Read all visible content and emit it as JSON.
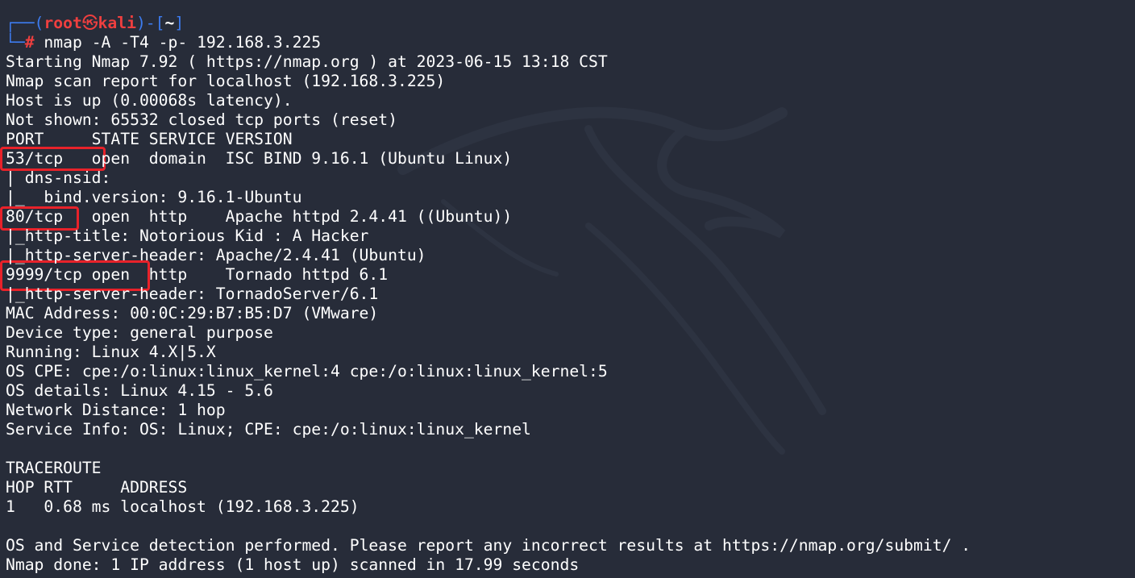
{
  "prompt": {
    "top_left": "┌──(",
    "user": "root",
    "skull": "㉿",
    "host": "kali",
    "mid": ")-[",
    "dir": "~",
    "end": "]",
    "bottom_left": "└─",
    "hash": "#",
    "command": " nmap -A -T4 -p- 192.168.3.225"
  },
  "output_lines": [
    "Starting Nmap 7.92 ( https://nmap.org ) at 2023-06-15 13:18 CST",
    "Nmap scan report for localhost (192.168.3.225)",
    "Host is up (0.00068s latency).",
    "Not shown: 65532 closed tcp ports (reset)",
    "PORT     STATE SERVICE VERSION",
    "53/tcp   open  domain  ISC BIND 9.16.1 (Ubuntu Linux)",
    "| dns-nsid: ",
    "|_  bind.version: 9.16.1-Ubuntu",
    "80/tcp   open  http    Apache httpd 2.4.41 ((Ubuntu))",
    "|_http-title: Notorious Kid : A Hacker",
    "|_http-server-header: Apache/2.4.41 (Ubuntu)",
    "9999/tcp open  http    Tornado httpd 6.1",
    "|_http-server-header: TornadoServer/6.1",
    "MAC Address: 00:0C:29:B7:B5:D7 (VMware)",
    "Device type: general purpose",
    "Running: Linux 4.X|5.X",
    "OS CPE: cpe:/o:linux:linux_kernel:4 cpe:/o:linux:linux_kernel:5",
    "OS details: Linux 4.15 - 5.6",
    "Network Distance: 1 hop",
    "Service Info: OS: Linux; CPE: cpe:/o:linux:linux_kernel",
    "",
    "TRACEROUTE",
    "HOP RTT     ADDRESS",
    "1   0.68 ms localhost (192.168.3.225)",
    "",
    "OS and Service detection performed. Please report any incorrect results at https://nmap.org/submit/ .",
    "Nmap done: 1 IP address (1 host up) scanned in 17.99 seconds"
  ],
  "colors": {
    "background": "#272c39",
    "prompt_red": "#ef3f3f",
    "prompt_blue": "#3d7cf0",
    "highlight_red": "#e8222a",
    "text": "#ffffff"
  },
  "icons": {
    "watermark": "kali-dragon-icon"
  }
}
